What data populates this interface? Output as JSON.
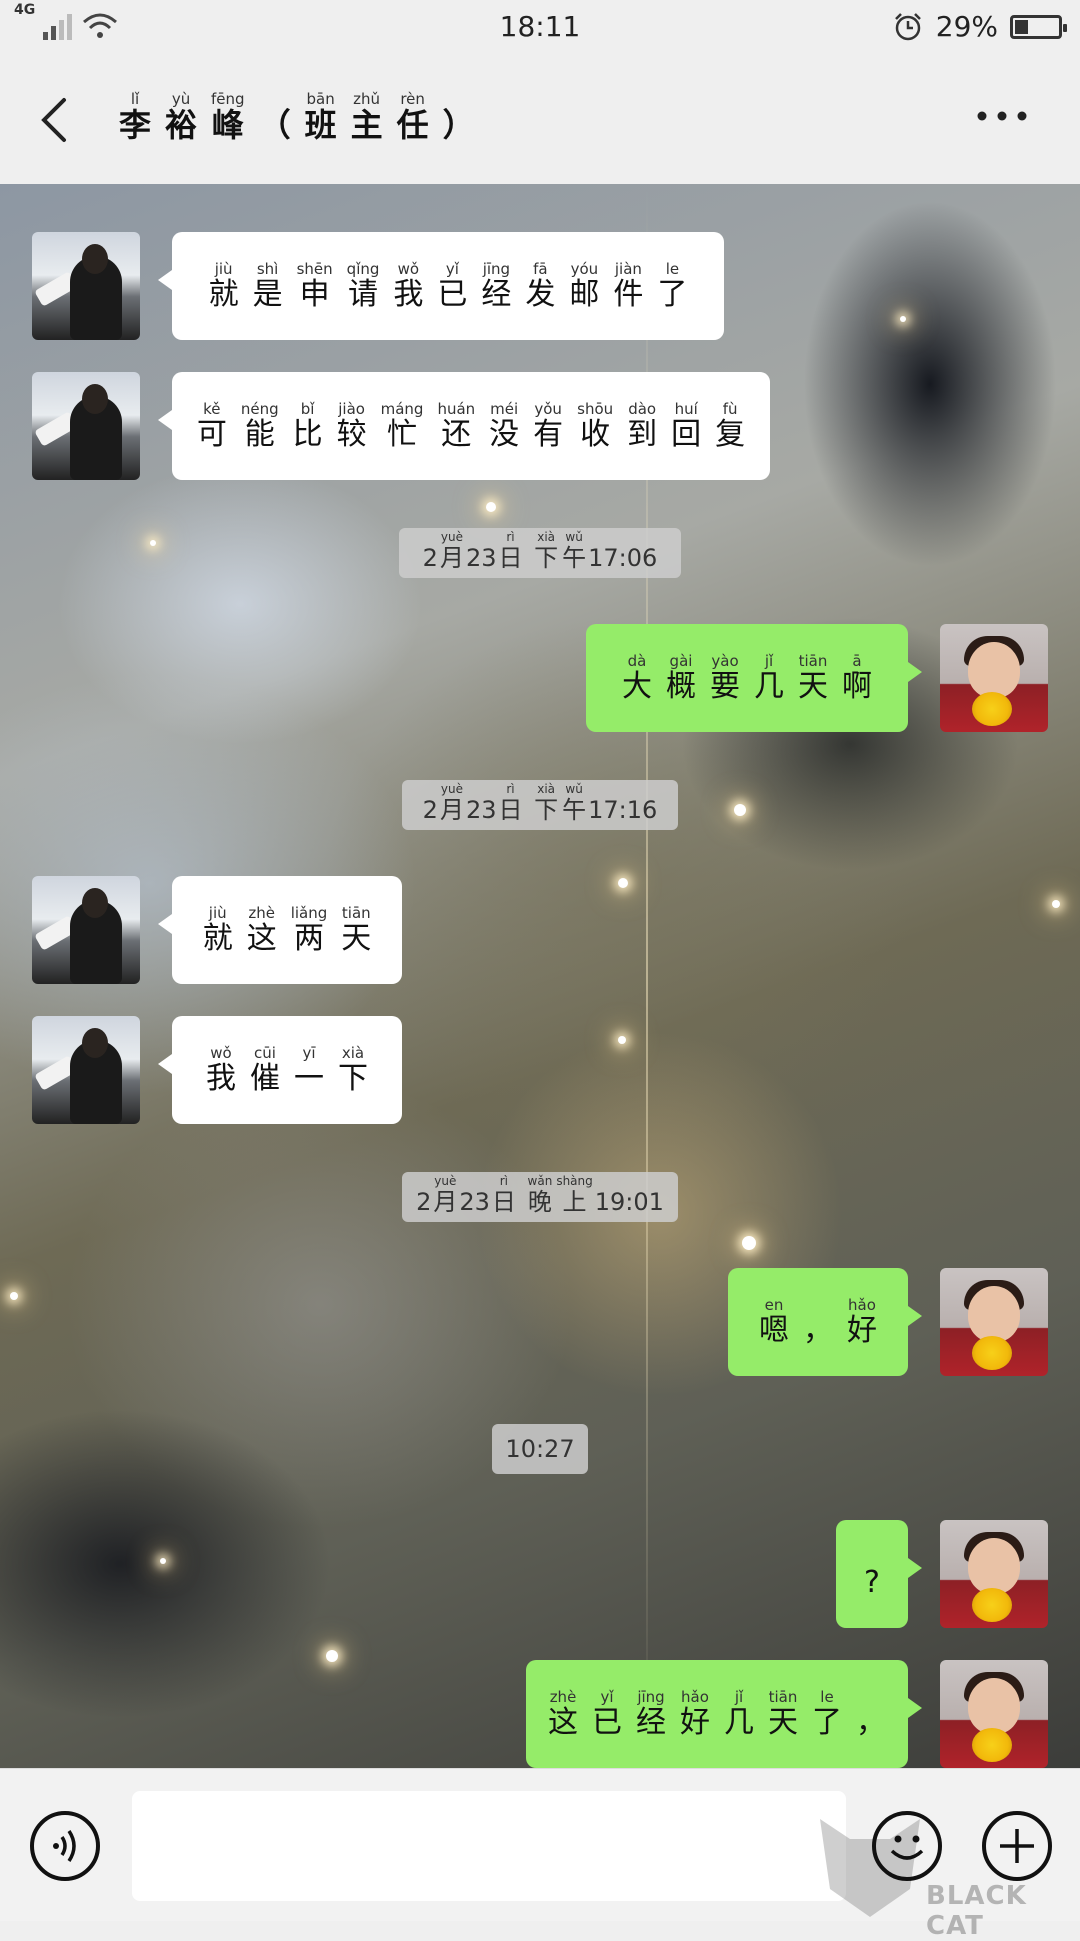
{
  "status_bar": {
    "network": "4G",
    "time": "18:11",
    "battery_percent": "29%",
    "battery_level": 0.29
  },
  "header": {
    "title": [
      {
        "hz": "李",
        "py": "lǐ"
      },
      {
        "hz": "裕",
        "py": "yù"
      },
      {
        "hz": "峰",
        "py": "fēng"
      },
      {
        "hz": "（",
        "py": ""
      },
      {
        "hz": "班",
        "py": "bān"
      },
      {
        "hz": "主",
        "py": "zhǔ"
      },
      {
        "hz": "任",
        "py": "rèn"
      },
      {
        "hz": "）",
        "py": ""
      }
    ]
  },
  "messages": [
    {
      "type": "in",
      "words": [
        {
          "hz": "就",
          "py": "jiù"
        },
        {
          "hz": "是",
          "py": "shì"
        },
        {
          "hz": "申",
          "py": "shēn"
        },
        {
          "hz": "请",
          "py": "qǐng"
        },
        {
          "hz": "我",
          "py": "wǒ"
        },
        {
          "hz": "已",
          "py": "yǐ"
        },
        {
          "hz": "经",
          "py": "jīng"
        },
        {
          "hz": "发",
          "py": "fā"
        },
        {
          "hz": "邮",
          "py": "yóu"
        },
        {
          "hz": "件",
          "py": "jiàn"
        },
        {
          "hz": "了",
          "py": "le"
        }
      ]
    },
    {
      "type": "in",
      "words": [
        {
          "hz": "可",
          "py": "kě"
        },
        {
          "hz": "能",
          "py": "néng"
        },
        {
          "hz": "比",
          "py": "bǐ"
        },
        {
          "hz": "较",
          "py": "jiào"
        },
        {
          "hz": "忙",
          "py": "máng"
        },
        {
          "hz": "还",
          "py": "huán"
        },
        {
          "hz": "没",
          "py": "méi"
        },
        {
          "hz": "有",
          "py": "yǒu"
        },
        {
          "hz": "收",
          "py": "shōu"
        },
        {
          "hz": "到",
          "py": "dào"
        },
        {
          "hz": "回",
          "py": "huí"
        },
        {
          "hz": "复",
          "py": "fù"
        }
      ]
    },
    {
      "type": "time",
      "parts": [
        {
          "t": "2"
        },
        {
          "hz": "月",
          "py": "yuè"
        },
        {
          "t": "23"
        },
        {
          "hz": "日",
          "py": "rì"
        },
        {
          "t": " "
        },
        {
          "hz": "下",
          "py": "xià"
        },
        {
          "hz": "午",
          "py": "wǔ"
        },
        {
          "t": "17:06"
        }
      ]
    },
    {
      "type": "out",
      "words": [
        {
          "hz": "大",
          "py": "dà"
        },
        {
          "hz": "概",
          "py": "gài"
        },
        {
          "hz": "要",
          "py": "yào"
        },
        {
          "hz": "几",
          "py": "jǐ"
        },
        {
          "hz": "天",
          "py": "tiān"
        },
        {
          "hz": "啊",
          "py": "ā"
        }
      ]
    },
    {
      "type": "time",
      "parts": [
        {
          "t": "2"
        },
        {
          "hz": "月",
          "py": "yuè"
        },
        {
          "t": "23"
        },
        {
          "hz": "日",
          "py": "rì"
        },
        {
          "t": " "
        },
        {
          "hz": "下",
          "py": "xià"
        },
        {
          "hz": "午",
          "py": "wǔ"
        },
        {
          "t": "17:16"
        }
      ]
    },
    {
      "type": "in",
      "words": [
        {
          "hz": "就",
          "py": "jiù"
        },
        {
          "hz": "这",
          "py": "zhè"
        },
        {
          "hz": "两",
          "py": "liǎng"
        },
        {
          "hz": "天",
          "py": "tiān"
        }
      ]
    },
    {
      "type": "in",
      "words": [
        {
          "hz": "我",
          "py": "wǒ"
        },
        {
          "hz": "催",
          "py": "cūi"
        },
        {
          "hz": "一",
          "py": "yī"
        },
        {
          "hz": "下",
          "py": "xià"
        }
      ]
    },
    {
      "type": "time",
      "parts": [
        {
          "t": "2"
        },
        {
          "hz": "月",
          "py": "yuè"
        },
        {
          "t": "23"
        },
        {
          "hz": "日",
          "py": "rì"
        },
        {
          "t": " "
        },
        {
          "hz": "晚",
          "py": "wǎn"
        },
        {
          "hz": "上",
          "py": "shàng"
        },
        {
          "t": "19:01"
        }
      ]
    },
    {
      "type": "out",
      "words": [
        {
          "hz": "嗯",
          "py": "en"
        },
        {
          "hz": "，",
          "py": ""
        },
        {
          "hz": "好",
          "py": "hǎo"
        }
      ]
    },
    {
      "type": "time",
      "parts": [
        {
          "t": "10:27"
        }
      ]
    },
    {
      "type": "out",
      "words": [
        {
          "hz": "?",
          "py": ""
        }
      ]
    },
    {
      "type": "out",
      "words": [
        {
          "hz": "这",
          "py": "zhè"
        },
        {
          "hz": "已",
          "py": "yǐ"
        },
        {
          "hz": "经",
          "py": "jīng"
        },
        {
          "hz": "好",
          "py": "hǎo"
        },
        {
          "hz": "几",
          "py": "jǐ"
        },
        {
          "hz": "天",
          "py": "tiān"
        },
        {
          "hz": "了",
          "py": "le"
        },
        {
          "hz": "，",
          "py": ""
        }
      ]
    }
  ],
  "input_bar": {
    "text_value": "",
    "watermark_text": "BLACK CAT"
  },
  "icons": {
    "back": "back-arrow-icon",
    "more": "more-dots-icon",
    "voice": "voice-icon",
    "emoji": "emoji-icon",
    "plus": "plus-icon"
  },
  "colors": {
    "outgoing_bubble": "#95ec69",
    "incoming_bubble": "#ffffff",
    "bar_background": "#efefef"
  }
}
